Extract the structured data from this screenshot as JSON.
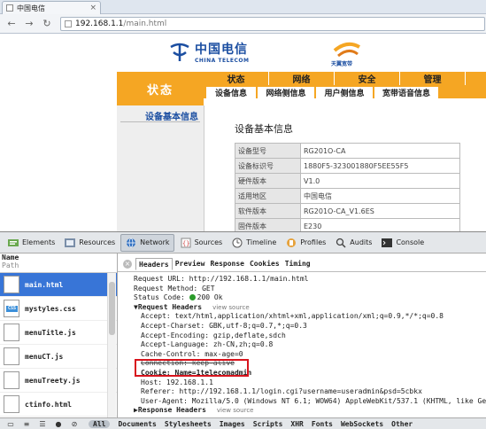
{
  "browser": {
    "tab_title": "中国电信",
    "url_host": "192.168.1.1",
    "url_path": "/main.html"
  },
  "router_page": {
    "brand_cn": "中国电信",
    "brand_en": "CHINA TELECOM",
    "tianyi": "天翼宽带",
    "left_section": "状态",
    "top_nav": [
      "状态",
      "网络",
      "安全",
      "管理"
    ],
    "sub_nav": [
      "设备信息",
      "网络侧信息",
      "用户侧信息",
      "宽带语音信息"
    ],
    "sidebar_link": "设备基本信息",
    "section_title": "设备基本信息",
    "info_rows": [
      {
        "k": "设备型号",
        "v": "RG201O-CA"
      },
      {
        "k": "设备标识号",
        "v": "1880F5-323001880F5EE55F5"
      },
      {
        "k": "硬件版本",
        "v": "V1.0"
      },
      {
        "k": "适用地区",
        "v": "中国电信"
      },
      {
        "k": "软件版本",
        "v": "RG201O-CA_V1.6ES"
      },
      {
        "k": "固件版本",
        "v": "E230"
      }
    ],
    "accent": "#f5a623"
  },
  "devtools": {
    "tools": [
      "Elements",
      "Resources",
      "Network",
      "Sources",
      "Timeline",
      "Profiles",
      "Audits",
      "Console"
    ],
    "name_header": "Name",
    "path_header": "Path",
    "resources": [
      "main.html",
      "mystyles.css",
      "menuTitle.js",
      "menuCT.js",
      "menuTreety.js",
      "ctinfo.html"
    ],
    "sub_tabs": [
      "Headers",
      "Preview",
      "Response",
      "Cookies",
      "Timing"
    ],
    "request_url_k": "Request URL:",
    "request_url_v": "http://192.168.1.1/main.html",
    "method_k": "Request Method:",
    "method_v": "GET",
    "status_k": "Status Code:",
    "status_v": "200 Ok",
    "req_headers_title": "▼Request Headers",
    "view_source": "view source",
    "accept": "Accept: text/html,application/xhtml+xml,application/xml;q=0.9,*/*;q=0.8",
    "accept_charset": "Accept-Charset: GBK,utf-8;q=0.7,*;q=0.3",
    "accept_encoding": "Accept-Encoding: gzip,deflate,sdch",
    "accept_language": "Accept-Language: zh-CN,zh;q=0.8",
    "cache_control": "Cache-Control: max-age=0",
    "connection": "Connection: keep-alive",
    "cookie": "Cookie: Name=1telecomadmin",
    "host": "Host: 192.168.1.1",
    "referer": "Referer: http://192.168.1.1/login.cgi?username=useradmin&psd=5cbkx",
    "user_agent": "User-Agent: Mozilla/5.0 (Windows NT 6.1; WOW64) AppleWebKit/537.1 (KHTML, like Gecko",
    "resp_headers_title": "▶Response Headers",
    "filters": [
      "All",
      "Documents",
      "Stylesheets",
      "Images",
      "Scripts",
      "XHR",
      "Fonts",
      "WebSockets",
      "Other"
    ]
  }
}
